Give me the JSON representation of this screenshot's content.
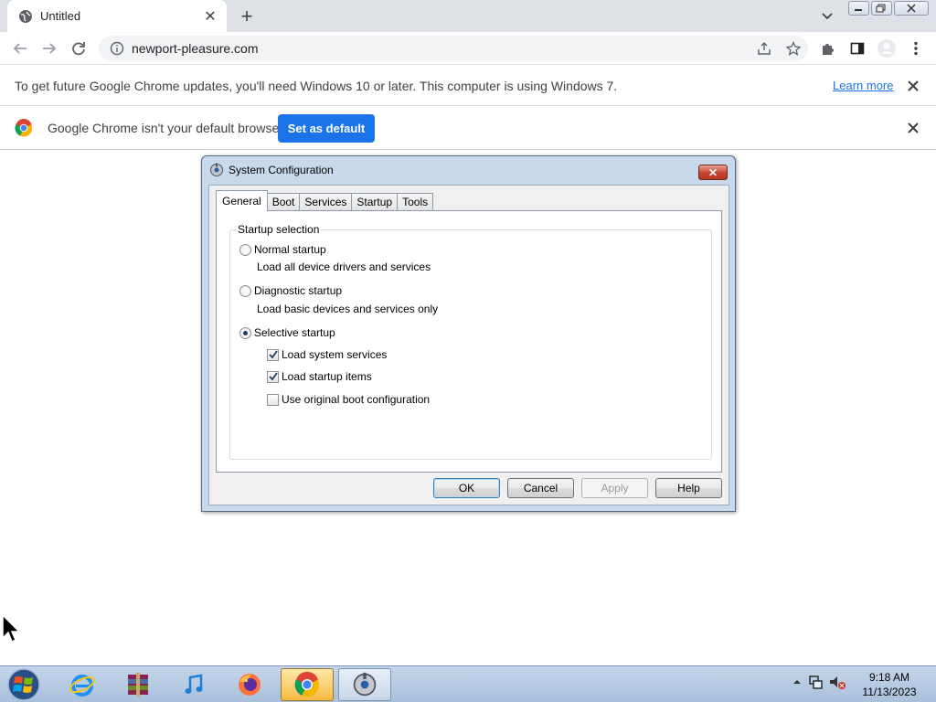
{
  "browser": {
    "tab_title": "Untitled",
    "url": "newport-pleasure.com"
  },
  "infobar_update": {
    "message": "To get future Google Chrome updates, you'll need Windows 10 or later. This computer is using Windows 7.",
    "link": "Learn more"
  },
  "infobar_default": {
    "message": "Google Chrome isn't your default browser",
    "button": "Set as default"
  },
  "dialog": {
    "title": "System Configuration",
    "tabs": [
      "General",
      "Boot",
      "Services",
      "Startup",
      "Tools"
    ],
    "active_tab": "General",
    "group_label": "Startup selection",
    "options": {
      "normal": {
        "label": "Normal startup",
        "desc": "Load all device drivers and services",
        "selected": false
      },
      "diagnostic": {
        "label": "Diagnostic startup",
        "desc": "Load basic devices and services only",
        "selected": false
      },
      "selective": {
        "label": "Selective startup",
        "selected": true
      }
    },
    "checks": {
      "system_services": {
        "label": "Load system services",
        "checked": true
      },
      "startup_items": {
        "label": "Load startup items",
        "checked": true
      },
      "original_boot": {
        "label": "Use original boot configuration",
        "checked": false
      }
    },
    "buttons": {
      "ok": "OK",
      "cancel": "Cancel",
      "apply": "Apply",
      "help": "Help"
    }
  },
  "taskbar": {
    "time": "9:18 AM",
    "date": "11/13/2023"
  },
  "colors": {
    "chrome_blue": "#1a73e8",
    "dialog_frame": "#c9d9ec",
    "taskbar": "#b6c9e3"
  }
}
